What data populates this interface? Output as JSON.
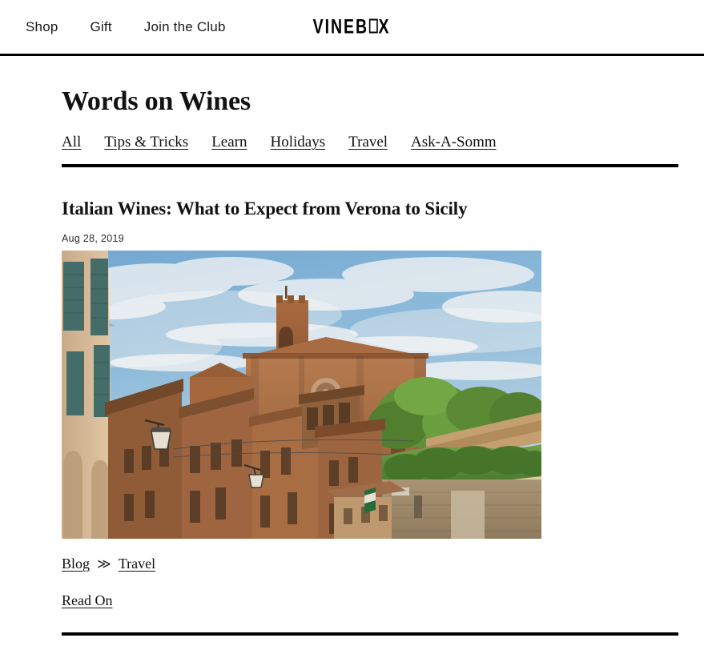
{
  "header": {
    "nav_items": [
      {
        "label": "Shop",
        "name": "nav-shop"
      },
      {
        "label": "Gift",
        "name": "nav-gift"
      },
      {
        "label": "Join the Club",
        "name": "nav-join-the-club"
      }
    ],
    "brand": {
      "full": "VINEBOX",
      "part1": "VINEB",
      "part2": "X"
    }
  },
  "blog": {
    "page_title": "Words on Wines",
    "categories": [
      {
        "label": "All"
      },
      {
        "label": "Tips & Tricks"
      },
      {
        "label": "Learn"
      },
      {
        "label": "Holidays"
      },
      {
        "label": "Travel"
      },
      {
        "label": "Ask-A-Somm"
      }
    ],
    "posts": [
      {
        "title": "Italian Wines: What to Expect from Verona to Sicily",
        "date": "Aug 28, 2019",
        "image_alt": "Italian hillside street in Siena with brick basilica, bell tower and cypress trees under a blue sky",
        "breadcrumb": {
          "root": "Blog",
          "separator": "≫",
          "category": "Travel"
        },
        "read_more": "Read On"
      }
    ]
  },
  "colors": {
    "text": "#111111",
    "rule": "#000000",
    "background": "#ffffff",
    "sky": "#7FB4DC",
    "brick": "#A9693F",
    "stone": "#C9A579",
    "foliage": "#4E7F34"
  }
}
